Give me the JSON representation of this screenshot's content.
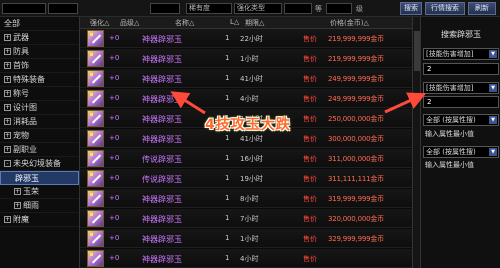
{
  "topbar": {
    "field1": "",
    "field2": "",
    "field3": "稀有度",
    "field4": "强化类型",
    "label_a": "等",
    "field5": "",
    "label_b": "级",
    "field6": "",
    "search_label": "搜索",
    "market_search_label": "行情搜索",
    "refresh_label": "刷新"
  },
  "sidebar": {
    "items": [
      {
        "label": "全部"
      },
      {
        "label": "武器",
        "box": "+"
      },
      {
        "label": "防具",
        "box": "+"
      },
      {
        "label": "首饰",
        "box": "+"
      },
      {
        "label": "特殊装备",
        "box": "+"
      },
      {
        "label": "称号",
        "box": "+"
      },
      {
        "label": "设计图",
        "box": "+"
      },
      {
        "label": "消耗品",
        "box": "+"
      },
      {
        "label": "宠物",
        "box": "+"
      },
      {
        "label": "副职业",
        "box": "+"
      },
      {
        "label": "未央幻境装备",
        "box": "-"
      },
      {
        "label": "辟邪玉"
      },
      {
        "label": "玉荣",
        "box": "+"
      },
      {
        "label": "细雨",
        "box": "+"
      },
      {
        "label": "附魔",
        "box": "+"
      }
    ]
  },
  "table": {
    "headers": {
      "enhance": "强化△",
      "grade": "品级△",
      "name": "名称△",
      "level": "L△",
      "time": "期限△",
      "price": "价格(金币)△"
    },
    "rows": [
      {
        "plus": "+0",
        "name": "神器辟邪玉",
        "qty": "1",
        "time": "22小时",
        "buy": "售价",
        "price": "219,999,999金币"
      },
      {
        "plus": "+0",
        "name": "神器辟邪玉",
        "qty": "1",
        "time": "1小时",
        "buy": "售价",
        "price": "219,999,999金币"
      },
      {
        "plus": "+0",
        "name": "神器辟邪玉",
        "qty": "1",
        "time": "41小时",
        "buy": "售价",
        "price": "249,999,999金币"
      },
      {
        "plus": "+0",
        "name": "神器辟邪玉",
        "qty": "1",
        "time": "4小时",
        "buy": "售价",
        "price": "249,999,999金币"
      },
      {
        "plus": "+0",
        "name": "神器辟邪玉",
        "qty": "1",
        "time": "11小时",
        "buy": "售价",
        "price": "250,000,000金币"
      },
      {
        "plus": "+0",
        "name": "神器辟邪玉",
        "qty": "1",
        "time": "41小时",
        "buy": "售价",
        "price": "300,000,000金币"
      },
      {
        "plus": "+0",
        "name": "传说辟邪玉",
        "qty": "1",
        "time": "16小时",
        "buy": "售价",
        "price": "311,000,000金币"
      },
      {
        "plus": "+0",
        "name": "传说辟邪玉",
        "qty": "1",
        "time": "19小时",
        "buy": "售价",
        "price": "311,111,111金币"
      },
      {
        "plus": "+0",
        "name": "神器辟邪玉",
        "qty": "1",
        "time": "8小时",
        "buy": "售价",
        "price": "319,999,999金币"
      },
      {
        "plus": "+0",
        "name": "神器辟邪玉",
        "qty": "1",
        "time": "7小时",
        "buy": "售价",
        "price": "320,000,000金币"
      },
      {
        "plus": "+0",
        "name": "神器辟邪玉",
        "qty": "1",
        "time": "1小时",
        "buy": "售价",
        "price": "329,999,999金币"
      },
      {
        "plus": "+0",
        "name": "神器辟邪玉",
        "qty": "1",
        "time": "4小时",
        "buy": "售价",
        "price": ""
      }
    ]
  },
  "panel": {
    "title": "搜索辟邪玉",
    "select1": "[技能伤害增加]",
    "input1": "2",
    "select2": "[技能伤害增加]",
    "input2": "2",
    "select3": "全部 (按属性搜)",
    "label3": "输入属性最小值",
    "select4": "全部 (按属性搜)",
    "label4": "输入属性最小值"
  },
  "overlay": {
    "caption": "4技攻玉大跌"
  },
  "colors": {
    "name_purple": "#c978ff",
    "price_red": "#ff6a52",
    "caption_orange": "#ff6a2a",
    "selected_blue": "#243a66"
  }
}
